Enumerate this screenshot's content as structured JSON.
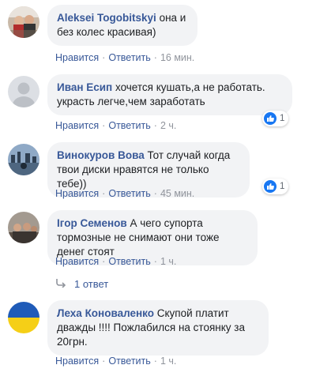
{
  "comments": [
    {
      "author": "Aleksei Togobitskyi",
      "text": "она и без колес красивая)",
      "like_label": "Нравится",
      "reply_label": "Ответить",
      "time": "16 мин."
    },
    {
      "author": "Иван Есип",
      "text": "хочется кушать,а не работать. украсть легче,чем заработать",
      "like_label": "Нравится",
      "reply_label": "Ответить",
      "time": "2 ч.",
      "reactions": "1"
    },
    {
      "author": "Винокуров Вова",
      "text": "Тот случай когда твои диски нравятся не только тебе))",
      "like_label": "Нравится",
      "reply_label": "Ответить",
      "time": "45 мин.",
      "reactions": "1"
    },
    {
      "author": "Ігор Семенов",
      "text": "А чего супорта тормозные не снимают они тоже денег стоят",
      "like_label": "Нравится",
      "reply_label": "Ответить",
      "time": "1 ч.",
      "replies": "1 ответ"
    },
    {
      "author": "Леха Коноваленко",
      "text": "Скупой платит дважды !!!! Пожлабился на стоянку за 20грн.",
      "like_label": "Нравится",
      "reply_label": "Ответить",
      "time": "1 ч."
    }
  ],
  "colors": {
    "link": "#385898",
    "bubble": "#f2f3f5",
    "meta": "#90949c",
    "like": "#1877f2"
  },
  "icons": [
    "reply-arrow-icon",
    "like-thumb-icon",
    "avatar-icons"
  ]
}
